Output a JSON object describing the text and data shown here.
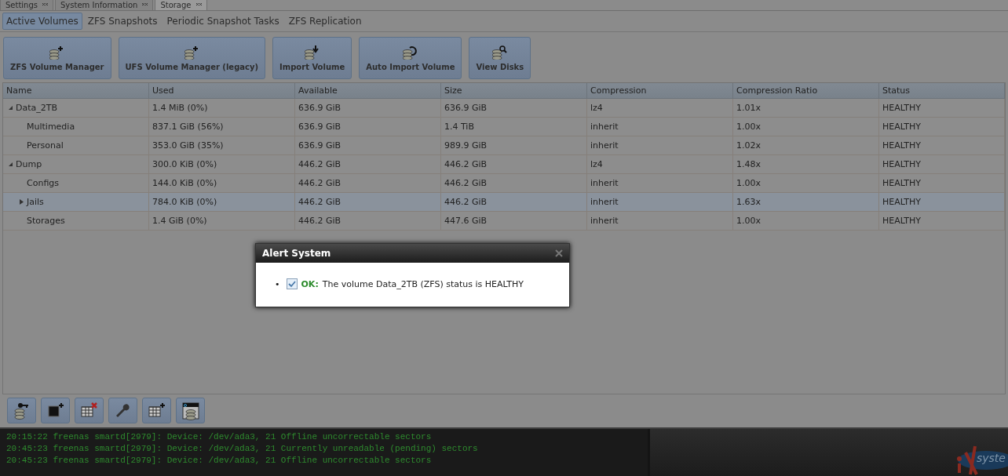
{
  "top_tabs": [
    {
      "label": "Settings",
      "selected": false
    },
    {
      "label": "System Information",
      "selected": false
    },
    {
      "label": "Storage",
      "selected": true
    }
  ],
  "sub_tabs": [
    {
      "label": "Active Volumes",
      "selected": true
    },
    {
      "label": "ZFS Snapshots",
      "selected": false
    },
    {
      "label": "Periodic Snapshot Tasks",
      "selected": false
    },
    {
      "label": "ZFS Replication",
      "selected": false
    }
  ],
  "toolbar": [
    {
      "label": "ZFS Volume Manager",
      "kind": "add"
    },
    {
      "label": "UFS Volume Manager (legacy)",
      "kind": "add"
    },
    {
      "label": "Import Volume",
      "kind": "import"
    },
    {
      "label": "Auto Import Volume",
      "kind": "refresh"
    },
    {
      "label": "View Disks",
      "kind": "search"
    }
  ],
  "table": {
    "columns": [
      "Name",
      "Used",
      "Available",
      "Size",
      "Compression",
      "Compression Ratio",
      "Status"
    ],
    "rows": [
      {
        "cells": [
          "Data_2TB",
          "1.4 MiB (0%)",
          "636.9 GiB",
          "636.9 GiB",
          "lz4",
          "1.01x",
          "HEALTHY"
        ],
        "expanded": true,
        "selected": false,
        "children": [
          {
            "cells": [
              "Multimedia",
              "837.1 GiB (56%)",
              "636.9 GiB",
              "1.4 TiB",
              "inherit",
              "1.00x",
              "HEALTHY"
            ],
            "selected": false
          },
          {
            "cells": [
              "Personal",
              "353.0 GiB (35%)",
              "636.9 GiB",
              "989.9 GiB",
              "inherit",
              "1.02x",
              "HEALTHY"
            ],
            "selected": false
          }
        ]
      },
      {
        "cells": [
          "Dump",
          "300.0 KiB (0%)",
          "446.2 GiB",
          "446.2 GiB",
          "lz4",
          "1.48x",
          "HEALTHY"
        ],
        "expanded": true,
        "selected": false,
        "children": [
          {
            "cells": [
              "Configs",
              "144.0 KiB (0%)",
              "446.2 GiB",
              "446.2 GiB",
              "inherit",
              "1.00x",
              "HEALTHY"
            ],
            "selected": false
          },
          {
            "cells": [
              "Jails",
              "784.0 KiB (0%)",
              "446.2 GiB",
              "446.2 GiB",
              "inherit",
              "1.63x",
              "HEALTHY"
            ],
            "expanded": false,
            "selected": true
          },
          {
            "cells": [
              "Storages",
              "1.4 GiB (0%)",
              "446.2 GiB",
              "447.6 GiB",
              "inherit",
              "1.00x",
              "HEALTHY"
            ],
            "selected": false
          }
        ]
      }
    ]
  },
  "bottom_toolbar": [
    {
      "kind": "key"
    },
    {
      "kind": "add-dataset"
    },
    {
      "kind": "delete"
    },
    {
      "kind": "wrench"
    },
    {
      "kind": "add-table"
    },
    {
      "kind": "disk-window"
    }
  ],
  "console": [
    "20:15:22 freenas smartd[2979]: Device: /dev/ada3, 21 Offline uncorrectable sectors",
    "20:45:23 freenas smartd[2979]: Device: /dev/ada3, 21 Currently unreadable (pending) sectors",
    "20:45:23 freenas smartd[2979]: Device: /dev/ada3, 21 Offline uncorrectable sectors"
  ],
  "logo": {
    "text": "syste"
  },
  "dialog": {
    "title": "Alert System",
    "alerts": [
      {
        "bullet": "•",
        "checked": true,
        "level": "OK:",
        "message": "The volume Data_2TB (ZFS) status is HEALTHY"
      }
    ]
  }
}
